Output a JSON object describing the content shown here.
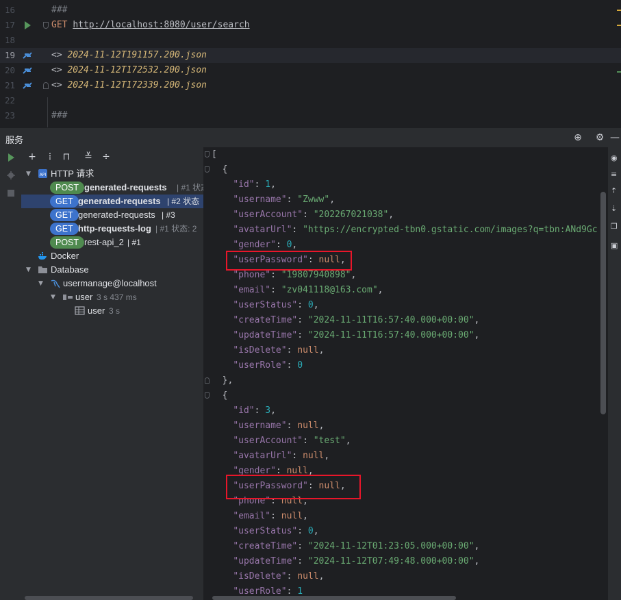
{
  "editor": {
    "lines": [
      {
        "num": "16",
        "text": "###"
      },
      {
        "num": "17",
        "method": "GET",
        "url": "http://localhost:8080/user/search"
      },
      {
        "num": "18",
        "text": ""
      },
      {
        "num": "19",
        "prefix": "<>",
        "file": "2024-11-12T191157.200.json"
      },
      {
        "num": "20",
        "prefix": "<>",
        "file": "2024-11-12T172532.200.json"
      },
      {
        "num": "21",
        "prefix": "<>",
        "file": "2024-11-12T172339.200.json"
      },
      {
        "num": "22",
        "text": ""
      },
      {
        "num": "23",
        "text": "###"
      }
    ]
  },
  "services_panel": {
    "title": "服务"
  },
  "tree": {
    "http_group": "HTTP 请求",
    "requests": [
      {
        "method": "POST",
        "name": "generated-requests",
        "suffix": "| #1 状态"
      },
      {
        "method": "GET",
        "name": "generated-requests",
        "suffix": "| #2 状态"
      },
      {
        "method": "GET",
        "name": "generated-requests",
        "suffix": "| #3"
      },
      {
        "method": "GET",
        "name": "http-requests-log",
        "suffix": "| #1 状态: 2"
      },
      {
        "method": "POST",
        "name": "rest-api_2",
        "suffix": "| #1"
      }
    ],
    "docker": "Docker",
    "database": "Database",
    "datasource": "usermanage@localhost",
    "session": {
      "name": "user",
      "time": "3 s 437 ms"
    },
    "table": {
      "name": "user",
      "time": "3 s"
    }
  },
  "response": {
    "users": [
      {
        "id": "1",
        "username": "\"Zwww\"",
        "userAccount": "\"202267021038\"",
        "avatarUrl": "\"https://encrypted-tbn0.gstatic.com/images?q=tbn:ANd9Gc",
        "gender": "0",
        "userPassword": "null",
        "phone": "\"19807940898\"",
        "email": "\"zv041118@163.com\"",
        "userStatus": "0",
        "createTime": "\"2024-11-11T16:57:40.000+00:00\"",
        "updateTime": "\"2024-11-11T16:57:40.000+00:00\"",
        "isDelete": "null",
        "userRole": "0"
      },
      {
        "id": "3",
        "username": "null",
        "userAccount": "\"test\"",
        "avatarUrl": "null",
        "gender": "null",
        "userPassword": "null",
        "phone": "null",
        "email": "null",
        "userStatus": "0",
        "createTime": "\"2024-11-12T01:23:05.000+00:00\"",
        "updateTime": "\"2024-11-12T07:49:48.000+00:00\"",
        "isDelete": "null",
        "userRole": "1"
      }
    ]
  },
  "colors": {
    "highlight_box": "#e8162a",
    "selection": "#2e436e",
    "get_badge": "#3d73cc",
    "post_badge": "#4f8a4f"
  }
}
